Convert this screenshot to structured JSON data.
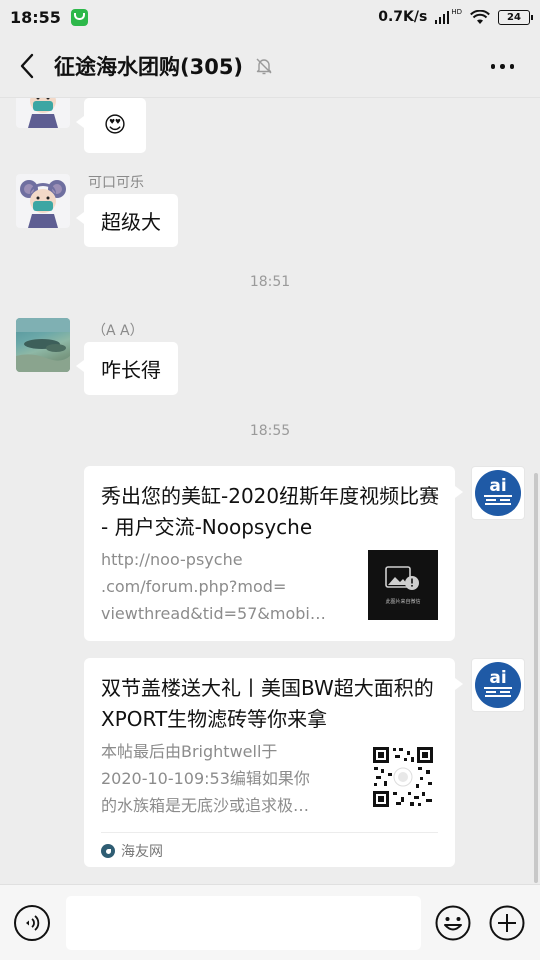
{
  "status_bar": {
    "time": "18:55",
    "network_speed": "0.7K/s",
    "hd_label": "HD",
    "battery": "24"
  },
  "header": {
    "title": "征途海水团购(305)",
    "icons": [
      "back-arrow",
      "mute-bell",
      "more-dots"
    ]
  },
  "messages": [
    {
      "type": "emoji",
      "sender": "",
      "avatar": "mouse",
      "emoji": "😍"
    },
    {
      "type": "text",
      "sender": "可口可乐",
      "avatar": "mouse",
      "text": "超级大"
    },
    {
      "type": "time",
      "text": "18:51"
    },
    {
      "type": "text",
      "sender": "（A A）",
      "avatar": "sea-photo",
      "text": "咋长得"
    },
    {
      "type": "time",
      "text": "18:55"
    },
    {
      "type": "link",
      "side": "right",
      "avatar": "ai-logo",
      "title": "秀出您的美缸-2020纽斯年度视频比赛 - 用户交流-Noopsyche",
      "desc_lines": [
        "http://noo-psyche",
        ".com/forum.php?mod=",
        "viewthread&tid=57&mobi…"
      ],
      "thumb_caption": "此图片来自微信"
    },
    {
      "type": "link",
      "side": "right",
      "avatar": "ai-logo",
      "title": "双节盖楼送大礼丨美国BW超大面积的XPORT生物滤砖等你来拿",
      "desc_lines": [
        "本帖最后由Brightwell于",
        "2020-10-109:53编辑如果你",
        "的水族箱是无底沙或追求极…"
      ],
      "source": "海友网"
    }
  ],
  "input_bar": {
    "placeholder": ""
  },
  "colors": {
    "background": "#ededed",
    "bubble": "#ffffff",
    "source_logo": "#2f5d73"
  }
}
